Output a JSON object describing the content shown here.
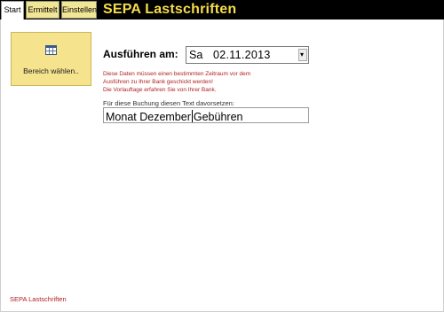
{
  "tabs": [
    {
      "label": "Start"
    },
    {
      "label": "Ermittelt"
    },
    {
      "label": "Einstellen"
    }
  ],
  "app_title": "SEPA Lastschriften",
  "range_button": {
    "label": "Bereich wählen..",
    "icon": "table-grid-icon"
  },
  "execute": {
    "label": "Ausführen am:",
    "weekday": "Sa",
    "date": "02.11.2013",
    "dropdown_icon": "dropdown-arrow-icon"
  },
  "warning": {
    "line1": "Diese Daten müssen einen bestimmten Zeitraum vor dem",
    "line2": "Ausführen zu Ihrer Bank geschickt werden!",
    "line3": "Die Vorlauftage erfahren Sie von Ihrer Bank."
  },
  "booking": {
    "hint": "Für diese Buchung diesen Text davorsetzen:",
    "text_before_caret": "Monat Dezember",
    "text_after_caret": "Gebühren"
  },
  "footer": "SEPA Lastschriften",
  "colors": {
    "accent": "#f6dd4a",
    "tab_bg": "#f1e596",
    "button_bg": "#f5e38e",
    "warning": "#b22020"
  }
}
